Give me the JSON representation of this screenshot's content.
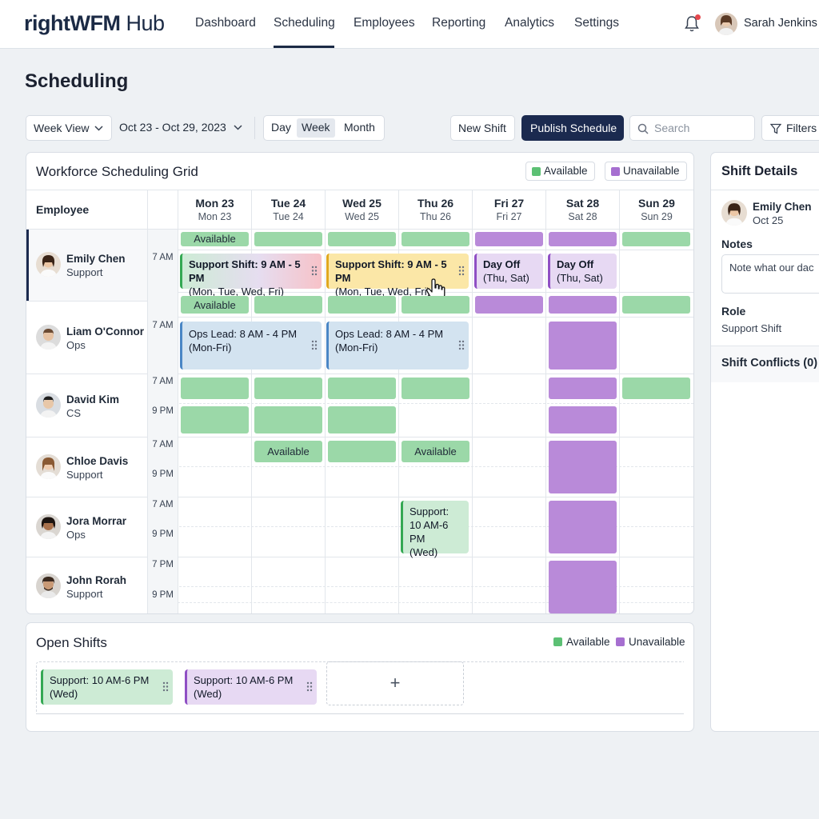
{
  "app": {
    "logo_bold": "rightWFM",
    "logo_light": "Hub"
  },
  "nav": {
    "items": [
      {
        "label": "Dashboard"
      },
      {
        "label": "Scheduling"
      },
      {
        "label": "Employees"
      },
      {
        "label": "Reporting"
      },
      {
        "label": "Analytics"
      },
      {
        "label": "Settings"
      }
    ],
    "active": "Scheduling"
  },
  "user": {
    "name": "Sarah Jenkins"
  },
  "page": {
    "title": "Scheduling"
  },
  "toolbar": {
    "view_select": "Week View",
    "date_range": "Oct 23 - Oct 29, 2023",
    "segments": [
      "Day",
      "Week",
      "Month"
    ],
    "active_segment": "Week",
    "new_shift": "New Shift",
    "publish": "Publish Schedule",
    "search_placeholder": "Search",
    "filters": "Filters"
  },
  "grid": {
    "title": "Workforce Scheduling Grid",
    "legend": {
      "available": "Available",
      "unavailable": "Unavailable"
    },
    "employee_header": "Employee",
    "days": [
      {
        "label": "Mon 23",
        "sub": "Mon 23"
      },
      {
        "label": "Tue 24",
        "sub": "Tue 24"
      },
      {
        "label": "Wed 25",
        "sub": "Wed 25"
      },
      {
        "label": "Thu 26",
        "sub": "Thu 26"
      },
      {
        "label": "Fri 27",
        "sub": "Fri 27"
      },
      {
        "label": "Sat 28",
        "sub": "Sat 28"
      },
      {
        "label": "Sun 29",
        "sub": "Sun 29"
      }
    ],
    "employees": [
      {
        "name": "Emily Chen",
        "role": "Support",
        "times": [
          "7 AM"
        ]
      },
      {
        "name": "Liam O'Connor",
        "role": "Ops",
        "times": [
          "7 AM"
        ]
      },
      {
        "name": "David Kim",
        "role": "CS",
        "times": [
          "7 AM",
          "9 PM"
        ]
      },
      {
        "name": "Chloe Davis",
        "role": "Support",
        "times": [
          "7 AM",
          "9 PM"
        ]
      },
      {
        "name": "Jora Morrar",
        "role": "Ops",
        "times": [
          "7 AM",
          "9 PM"
        ]
      },
      {
        "name": "John Rorah",
        "role": "Support",
        "times": [
          "7 PM",
          "9 PM"
        ]
      }
    ],
    "labels": {
      "available": "Available",
      "emily_shift_title": "Support Shift: 9 AM - 5 PM",
      "emily_shift_days": "(Mon, Tue, Wed, Fri)",
      "day_off_title": "Day Off",
      "day_off_days": "(Thu, Sat)",
      "liam_shift_title": "Ops Lead: 8 AM - 4 PM",
      "liam_shift_days": "(Mon-Fri)",
      "jora_shift_l1": "Support:",
      "jora_shift_l2": "10 AM-6 PM",
      "jora_shift_l3": "(Wed)"
    }
  },
  "open_shifts": {
    "title": "Open Shifts",
    "legend": {
      "available": "Available",
      "unavailable": "Unavailable"
    },
    "cards": [
      {
        "title": "Support: 10 AM-6 PM",
        "days": "(Wed)"
      },
      {
        "title": "Support: 10 AM-6 PM",
        "days": "(Wed)"
      }
    ],
    "add_symbol": "+"
  },
  "details": {
    "title": "Shift Details",
    "employee_name": "Emily Chen",
    "employee_date": "Oct 25",
    "notes_label": "Notes",
    "notes_value": "Note what our dac",
    "role_label": "Role",
    "role_value": "Support Shift",
    "conflicts": "Shift Conflicts (0)"
  },
  "colors": {
    "brand": "#1b2a4f",
    "available": "#9bd8a8",
    "unavailable": "#b98ad9",
    "alert": "#e5484d"
  }
}
